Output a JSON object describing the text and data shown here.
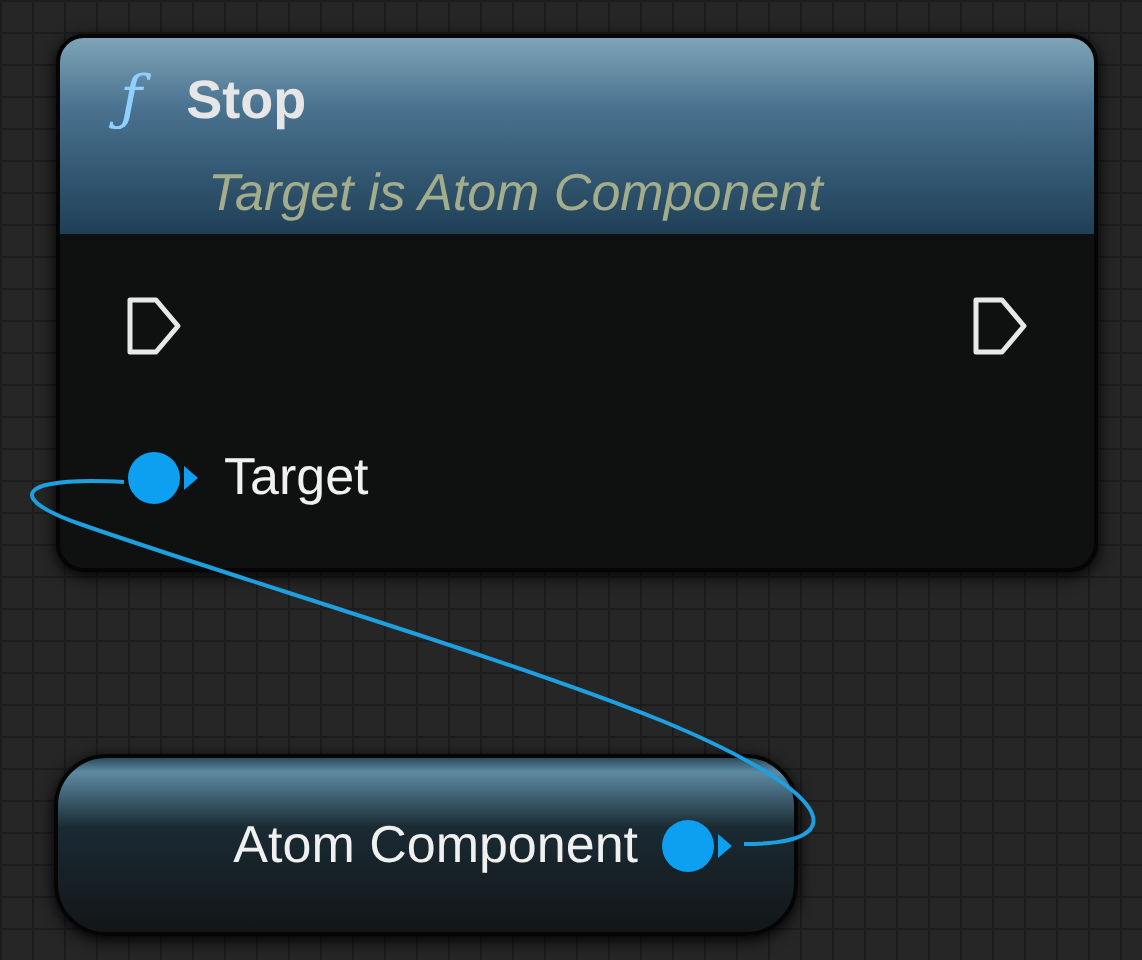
{
  "nodes": [
    {
      "kind": "function",
      "icon": "ƒ",
      "title": "Stop",
      "subtitle": "Target is Atom Component",
      "pins": [
        {
          "label": "Target"
        }
      ]
    },
    {
      "kind": "variable",
      "label": "Atom Component"
    }
  ]
}
